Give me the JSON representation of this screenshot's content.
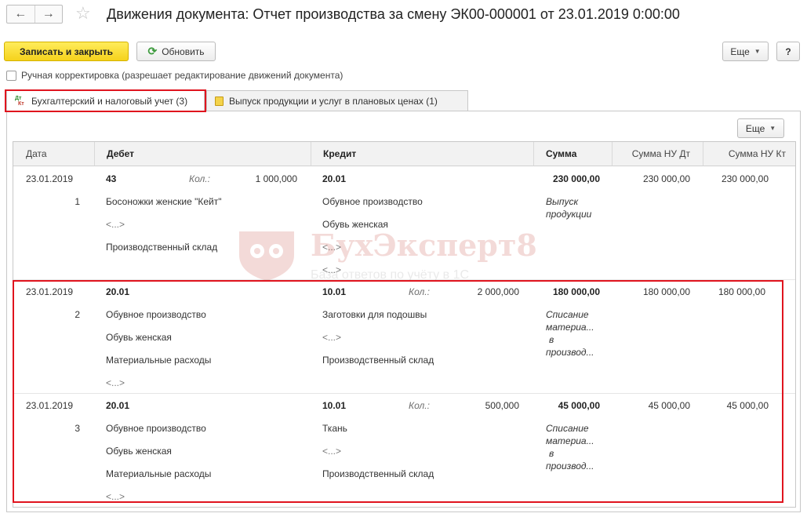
{
  "window": {
    "title": "Движения документа: Отчет производства за смену ЭК00-000001 от 23.01.2019 0:00:00"
  },
  "toolbar": {
    "save_close": "Записать и закрыть",
    "refresh": "Обновить",
    "more": "Еще",
    "help": "?"
  },
  "manual_adjust": {
    "label": "Ручная корректировка (разрешает редактирование движений документа)"
  },
  "tabs": [
    {
      "label": "Бухгалтерский и налоговый учет (3)",
      "icon": "dt-kt-icon"
    },
    {
      "label": "Выпуск продукции и услуг в плановых ценах (1)",
      "icon": "document-icon"
    }
  ],
  "panel": {
    "more": "Еще"
  },
  "table": {
    "columns": [
      "Дата",
      "Дебет",
      "Кредит",
      "Сумма",
      "Сумма НУ Дт",
      "Сумма НУ Кт"
    ],
    "rows": [
      {
        "date": "23.01.2019",
        "num": "1",
        "debit": {
          "account": "43",
          "qty_label": "Кол.:",
          "qty": "1 000,000",
          "sub1": "Босоножки женские \"Кейт\"",
          "sub2": "<...>",
          "sub3": "Производственный склад",
          "sub4": ""
        },
        "credit": {
          "account": "20.01",
          "qty_label": "",
          "qty": "",
          "sub1": "Обувное производство",
          "sub2": "Обувь женская",
          "sub3": "<...>",
          "sub4": "<...>"
        },
        "sum": "230 000,00",
        "sum_nu_dt": "230 000,00",
        "sum_nu_kt": "230 000,00",
        "content": [
          "Выпуск",
          "продукции"
        ]
      },
      {
        "date": "23.01.2019",
        "num": "2",
        "debit": {
          "account": "20.01",
          "qty_label": "",
          "qty": "",
          "sub1": "Обувное производство",
          "sub2": "Обувь женская",
          "sub3": "Материальные расходы",
          "sub4": "<...>"
        },
        "credit": {
          "account": "10.01",
          "qty_label": "Кол.:",
          "qty": "2 000,000",
          "sub1": "Заготовки для подошвы",
          "sub2": "<...>",
          "sub3": "Производственный склад",
          "sub4": ""
        },
        "sum": "180 000,00",
        "sum_nu_dt": "180 000,00",
        "sum_nu_kt": "180 000,00",
        "content": [
          "Списание",
          "материа...",
          "в",
          "производ..."
        ]
      },
      {
        "date": "23.01.2019",
        "num": "3",
        "debit": {
          "account": "20.01",
          "qty_label": "",
          "qty": "",
          "sub1": "Обувное производство",
          "sub2": "Обувь женская",
          "sub3": "Материальные расходы",
          "sub4": "<...>"
        },
        "credit": {
          "account": "10.01",
          "qty_label": "Кол.:",
          "qty": "500,000",
          "sub1": "Ткань",
          "sub2": "<...>",
          "sub3": "Производственный склад",
          "sub4": ""
        },
        "sum": "45 000,00",
        "sum_nu_dt": "45 000,00",
        "sum_nu_kt": "45 000,00",
        "content": [
          "Списание",
          "материа...",
          "в",
          "производ..."
        ]
      }
    ]
  },
  "watermark": {
    "brand": "БухЭксперт8",
    "tagline": "База ответов по учёту в 1С"
  },
  "colors": {
    "primary_button": "#f5d21c",
    "highlight": "#e0141e",
    "refresh_icon": "#3c9a3c"
  }
}
